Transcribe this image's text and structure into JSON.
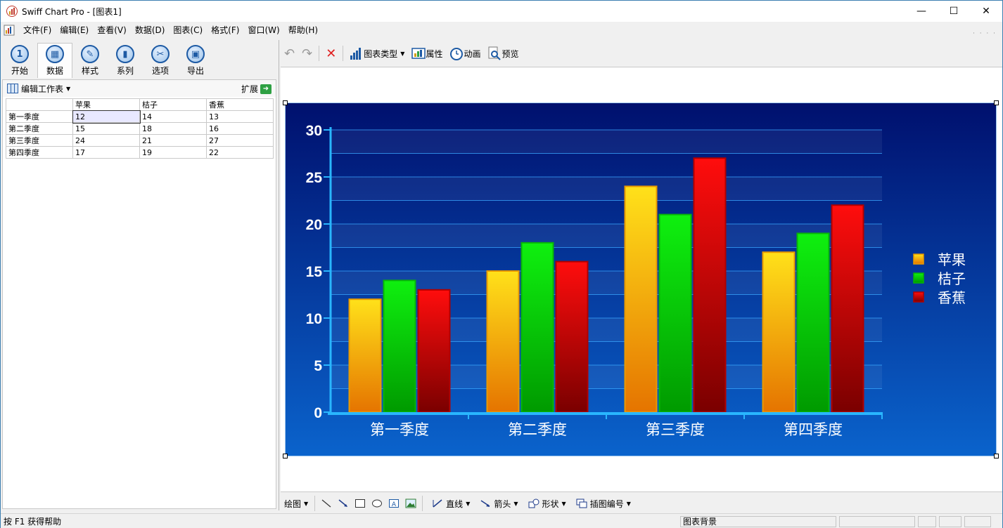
{
  "window": {
    "title": "Swiff Chart Pro - [图表1]",
    "controls": {
      "minimize": "—",
      "maximize": "☐",
      "close": "✕"
    }
  },
  "menu": {
    "items": [
      "文件(F)",
      "编辑(E)",
      "查看(V)",
      "数据(D)",
      "图表(C)",
      "格式(F)",
      "窗口(W)",
      "帮助(H)"
    ]
  },
  "nav": {
    "tabs": [
      {
        "label": "开始",
        "icon": "start-icon",
        "glyph": "1"
      },
      {
        "label": "数据",
        "icon": "data-grid-icon",
        "glyph": "▦"
      },
      {
        "label": "样式",
        "icon": "brush-icon",
        "glyph": "✎"
      },
      {
        "label": "系列",
        "icon": "series-bars-icon",
        "glyph": "▮"
      },
      {
        "label": "选项",
        "icon": "tools-icon",
        "glyph": "✂"
      },
      {
        "label": "导出",
        "icon": "save-disk-icon",
        "glyph": "▣"
      }
    ],
    "active_tab": "数据"
  },
  "sheet": {
    "title": "编辑工作表",
    "expand_label": "扩展",
    "columns": [
      "",
      "苹果",
      "桔子",
      "香蕉"
    ],
    "rows": [
      {
        "label": "第一季度",
        "values": [
          "12",
          "14",
          "13"
        ]
      },
      {
        "label": "第二季度",
        "values": [
          "15",
          "18",
          "16"
        ]
      },
      {
        "label": "第三季度",
        "values": [
          "24",
          "21",
          "27"
        ]
      },
      {
        "label": "第四季度",
        "values": [
          "17",
          "19",
          "22"
        ]
      }
    ]
  },
  "toolbar": {
    "chart_type_label": "图表类型",
    "properties_label": "属性",
    "animation_label": "动画",
    "preview_label": "预览"
  },
  "drawbar": {
    "draw_label": "绘图",
    "line_label": "直线",
    "arrow_label": "箭头",
    "shape_label": "形状",
    "figure_number_label": "插图编号"
  },
  "status": {
    "help_text": "按 F1 获得帮助",
    "selection_text": "图表背景"
  },
  "colors": {
    "chart_bg_top": "#000e6b",
    "chart_bg_bottom": "#0a5cc4",
    "apple": "#f5b800",
    "orange": "#16c916",
    "banana": "#dd0000",
    "axis": "#29b6ff"
  },
  "chart_data": {
    "type": "bar",
    "categories": [
      "第一季度",
      "第二季度",
      "第三季度",
      "第四季度"
    ],
    "series": [
      {
        "name": "苹果",
        "values": [
          12,
          15,
          24,
          17
        ]
      },
      {
        "name": "桔子",
        "values": [
          14,
          18,
          21,
          19
        ]
      },
      {
        "name": "香蕉",
        "values": [
          13,
          16,
          27,
          22
        ]
      }
    ],
    "ylim": [
      0,
      30
    ],
    "yticks": [
      0,
      5,
      10,
      15,
      20,
      25,
      30
    ],
    "grid": true,
    "legend_position": "right"
  }
}
